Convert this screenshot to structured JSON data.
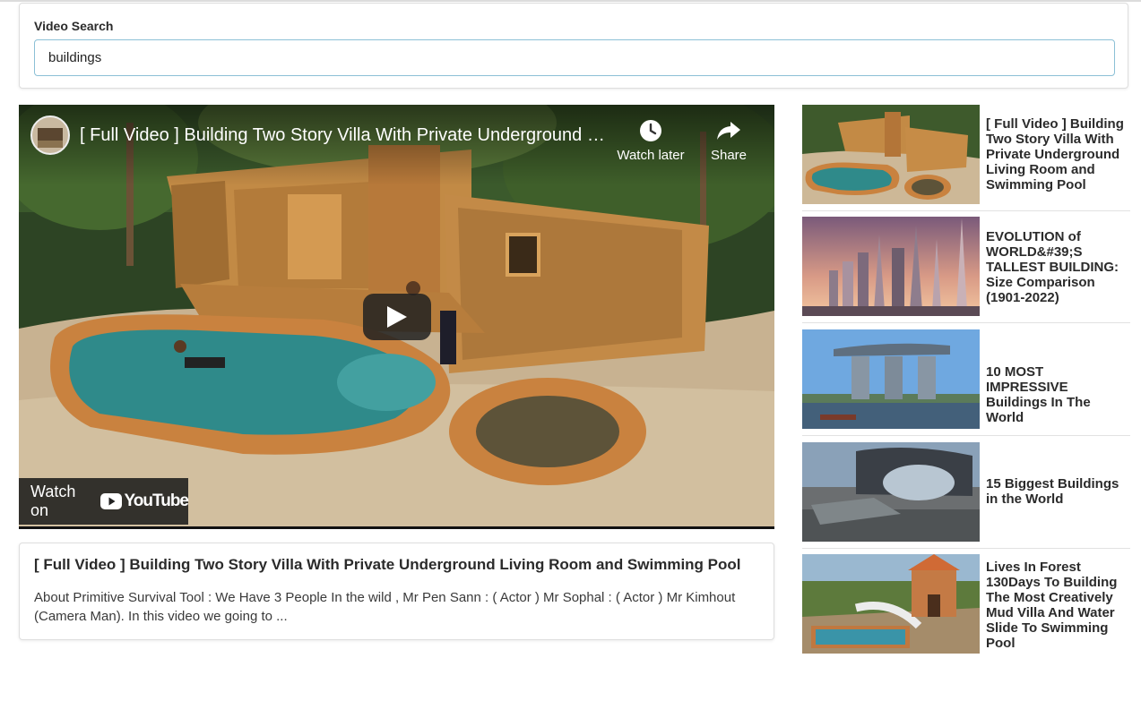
{
  "search": {
    "label": "Video Search",
    "value": "buildings"
  },
  "player": {
    "title": "[ Full Video ] Building Two Story Villa With Private Underground Li...",
    "watch_later_label": "Watch later",
    "share_label": "Share",
    "watch_on_label": "Watch on",
    "youtube_label": "YouTube"
  },
  "selected_video": {
    "title": "[ Full Video ] Building Two Story Villa With Private Underground Living Room and Swimming Pool",
    "description": "About Primitive Survival Tool : We Have 3 People In the wild , Mr Pen Sann : ( Actor ) Mr Sophal : ( Actor ) Mr Kimhout (Camera Man). In this video we going to ..."
  },
  "results": [
    {
      "title": "[ Full Video ] Building Two Story Villa With Private Underground Living Room and Swimming Pool"
    },
    {
      "title": "EVOLUTION of WORLD&#39;S TALLEST BUILDING: Size Comparison (1901-2022)"
    },
    {
      "title": "10 MOST IMPRESSIVE Buildings In The World"
    },
    {
      "title": "15 Biggest Buildings in the World"
    },
    {
      "title": "Lives In Forest 130Days To Building The Most Creatively Mud Villa And Water Slide To Swimming Pool"
    }
  ],
  "icons": {
    "watch_later": "clock-icon",
    "share": "share-arrow-icon",
    "play": "play-icon",
    "youtube": "youtube-logo-icon"
  },
  "colors": {
    "input_border": "#8cc0d6",
    "youtube_red": "#ff0000"
  }
}
